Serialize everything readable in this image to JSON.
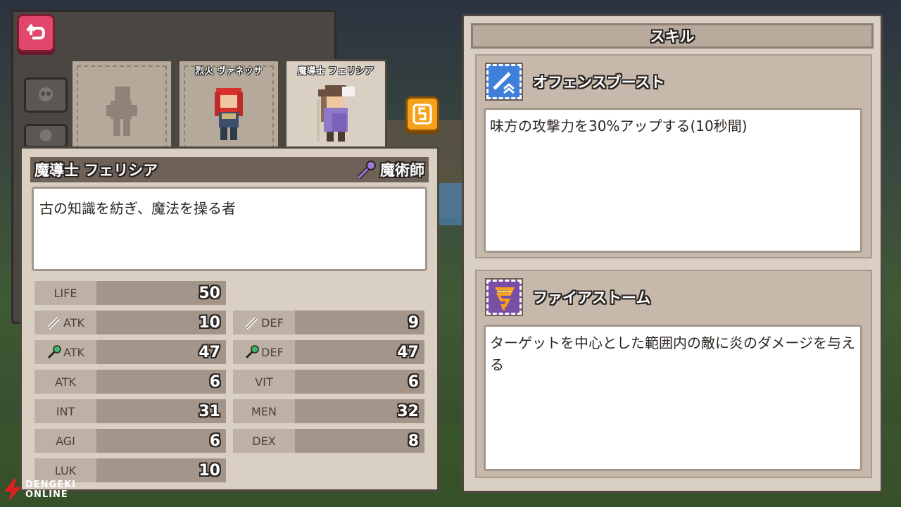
{
  "tabs": [
    {
      "label": "",
      "state": "locked"
    },
    {
      "label": "烈火 ヴァネッサ",
      "state": "normal"
    },
    {
      "label": "魔導士 フェリシア",
      "state": "active"
    }
  ],
  "character": {
    "name": "魔導士 フェリシア",
    "class_icon": "wand-icon",
    "class": "魔術師",
    "description": "古の知識を紡ぎ、魔法を操る者"
  },
  "stats": {
    "life": {
      "label": "LIFE",
      "value": "50"
    },
    "phys_atk": {
      "label": "ATK",
      "value": "10"
    },
    "phys_def": {
      "label": "DEF",
      "value": "9"
    },
    "mag_atk": {
      "label": "ATK",
      "value": "47"
    },
    "mag_def": {
      "label": "DEF",
      "value": "47"
    },
    "atk": {
      "label": "ATK",
      "value": "6"
    },
    "vit": {
      "label": "VIT",
      "value": "6"
    },
    "int": {
      "label": "INT",
      "value": "31"
    },
    "men": {
      "label": "MEN",
      "value": "32"
    },
    "agi": {
      "label": "AGI",
      "value": "6"
    },
    "dex": {
      "label": "DEX",
      "value": "8"
    },
    "luk": {
      "label": "LUK",
      "value": "10"
    }
  },
  "skills": {
    "title": "スキル",
    "items": [
      {
        "name": "オフェンスブースト",
        "icon": "sword-boost-icon",
        "icon_color": "#3f7fd9",
        "description": "味方の攻撃力を30%アップする(10秒間)"
      },
      {
        "name": "ファイアストーム",
        "icon": "fire-tornado-icon",
        "icon_color": "#7b4ea6",
        "description": "ターゲットを中心とした範囲内の敵に炎のダメージを与える"
      }
    ]
  },
  "watermark": {
    "line1": "DENGEKI",
    "line2": "ONLINE"
  },
  "colors": {
    "back_button": "#e0476a",
    "swap_button": "#f5a11c",
    "panel": "#d9cfc3",
    "header": "#6d6158"
  }
}
